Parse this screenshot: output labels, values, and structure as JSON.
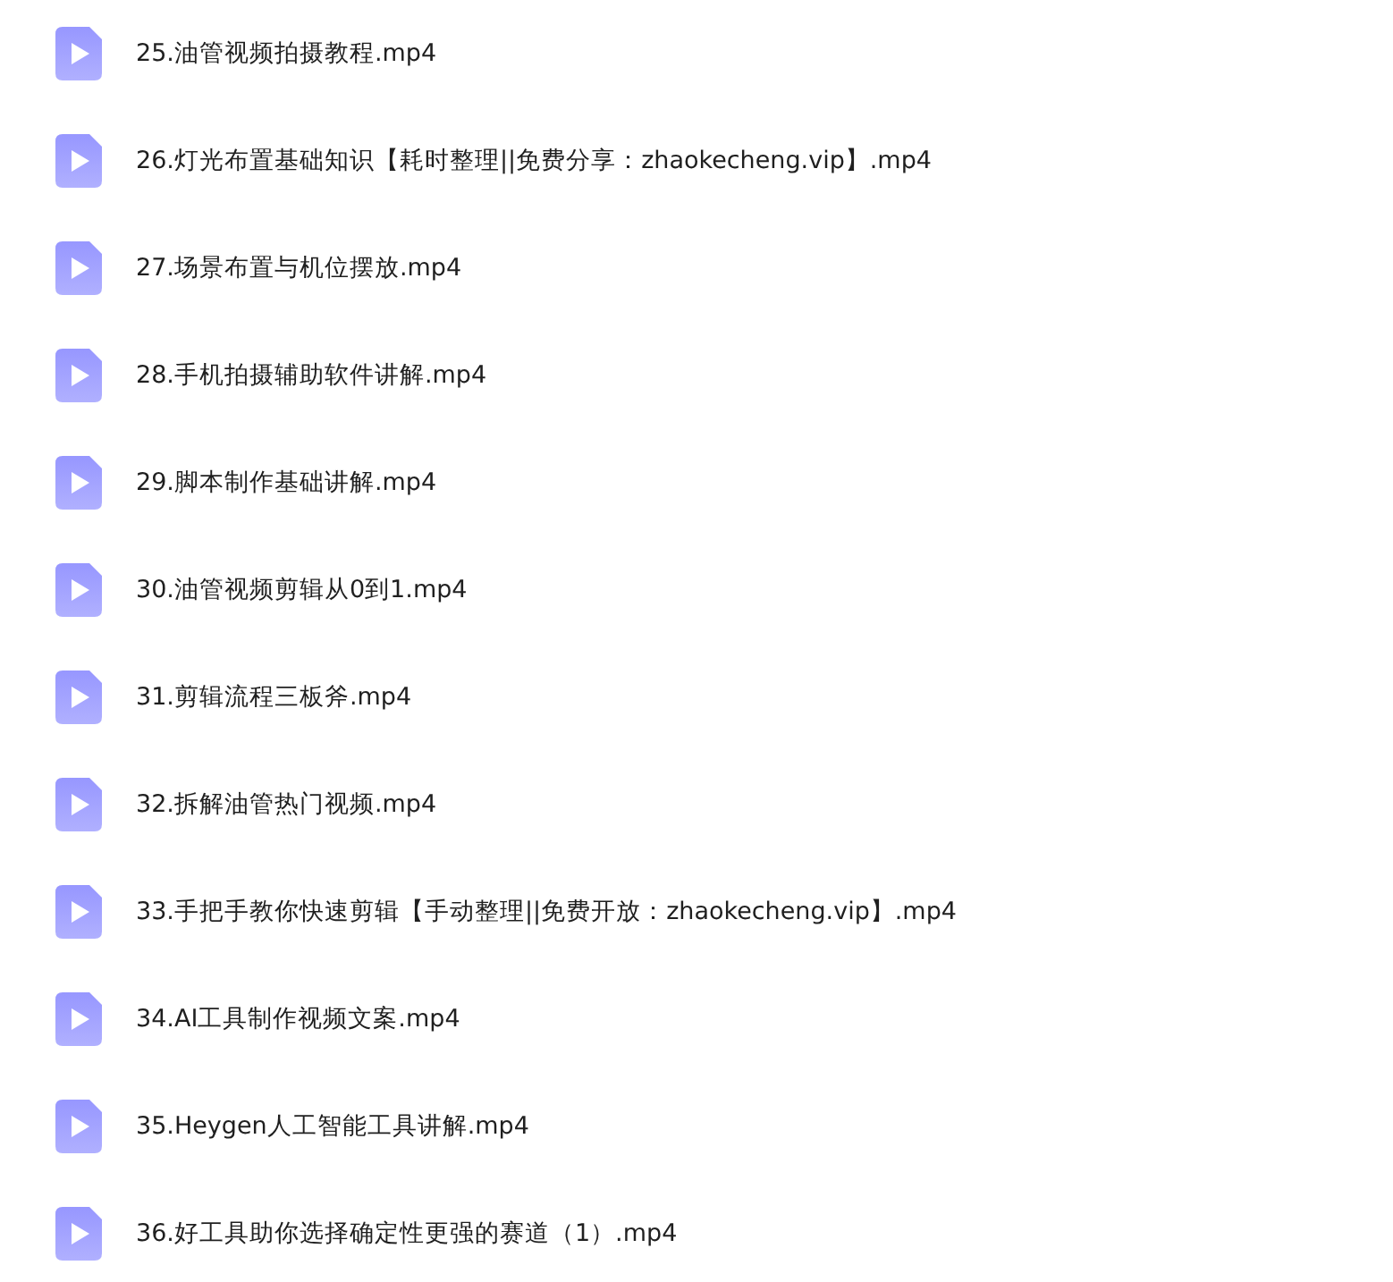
{
  "files": [
    {
      "name": "25.油管视频拍摄教程.mp4"
    },
    {
      "name": "26.灯光布置基础知识【耗时整理||免费分享：zhaokecheng.vip】.mp4"
    },
    {
      "name": "27.场景布置与机位摆放.mp4"
    },
    {
      "name": "28.手机拍摄辅助软件讲解.mp4"
    },
    {
      "name": "29.脚本制作基础讲解.mp4"
    },
    {
      "name": "30.油管视频剪辑从0到1.mp4"
    },
    {
      "name": "31.剪辑流程三板斧.mp4"
    },
    {
      "name": "32.拆解油管热门视频.mp4"
    },
    {
      "name": "33.手把手教你快速剪辑【手动整理||免费开放：zhaokecheng.vip】.mp4"
    },
    {
      "name": "34.AI工具制作视频文案.mp4"
    },
    {
      "name": "35.Heygen人工智能工具讲解.mp4"
    },
    {
      "name": "36.好工具助你选择确定性更强的赛道（1）.mp4"
    }
  ]
}
